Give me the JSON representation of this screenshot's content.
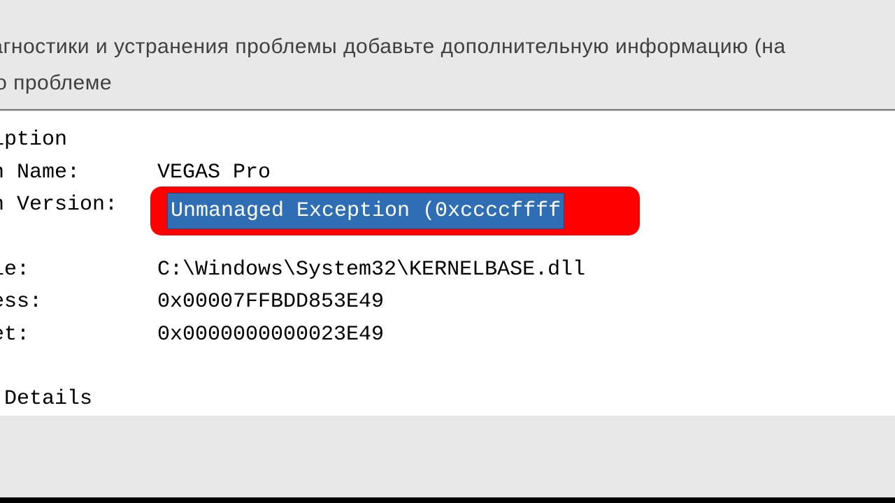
{
  "header": {
    "line1": "иагностики и устранения проблемы добавьте дополнительную информацию (на",
    "line2": "т о проблеме"
  },
  "details": {
    "description_label": "ription",
    "name_label": "on Name:",
    "name_value": "VEGAS Pro",
    "version_label": "on Version:",
    "exception_text": "Unmanaged Exception (0xccccffff",
    "module_label": "ule:",
    "module_value": "C:\\Windows\\System32\\KERNELBASE.dll",
    "address_label": "ress:",
    "address_value": "0x00007FFBDD853E49",
    "offset_label": "set:",
    "offset_value": "0x0000000000023E49",
    "section_details": "s Details"
  }
}
